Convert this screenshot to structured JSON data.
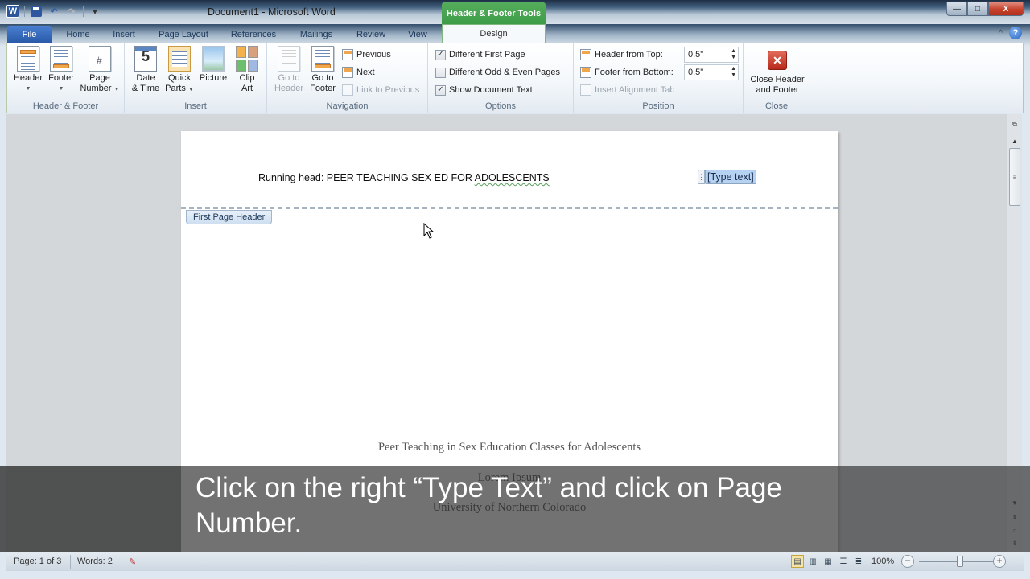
{
  "window": {
    "title": "Document1  -  Microsoft Word",
    "contextual_group": "Header & Footer Tools",
    "controls": {
      "minimize": "—",
      "maximize": "□",
      "close": "X"
    }
  },
  "quick_access": {
    "app_icon": "W",
    "undo": "↶",
    "redo": "↷",
    "customize": "▾"
  },
  "tabs": [
    {
      "label": "File",
      "active": false
    },
    {
      "label": "Home",
      "active": false
    },
    {
      "label": "Insert",
      "active": false
    },
    {
      "label": "Page Layout",
      "active": false
    },
    {
      "label": "References",
      "active": false
    },
    {
      "label": "Mailings",
      "active": false
    },
    {
      "label": "Review",
      "active": false
    },
    {
      "label": "View",
      "active": false
    },
    {
      "label": "Design",
      "active": true
    }
  ],
  "ribbon": {
    "collapse": "^",
    "help": "?",
    "groups": {
      "header_footer": {
        "label": "Header & Footer",
        "header": "Header",
        "footer": "Footer",
        "page_number_1": "Page",
        "page_number_2": "Number"
      },
      "insert": {
        "label": "Insert",
        "date_1": "Date",
        "date_2": "& Time",
        "quick_1": "Quick",
        "quick_2": "Parts",
        "picture": "Picture",
        "clip_1": "Clip",
        "clip_2": "Art"
      },
      "navigation": {
        "label": "Navigation",
        "goto_header_1": "Go to",
        "goto_header_2": "Header",
        "goto_footer_1": "Go to",
        "goto_footer_2": "Footer",
        "previous": "Previous",
        "next": "Next",
        "link_previous": "Link to Previous"
      },
      "options": {
        "label": "Options",
        "items": [
          {
            "label": "Different First Page",
            "checked": true
          },
          {
            "label": "Different Odd & Even Pages",
            "checked": false
          },
          {
            "label": "Show Document Text",
            "checked": true
          }
        ]
      },
      "position": {
        "label": "Position",
        "header_from_top_label": "Header from Top:",
        "header_from_top_value": "0.5\"",
        "footer_from_bottom_label": "Footer from Bottom:",
        "footer_from_bottom_value": "0.5\"",
        "insert_alignment_tab": "Insert Alignment Tab"
      },
      "close": {
        "label": "Close",
        "btn_1": "Close Header",
        "btn_2": "and Footer"
      }
    }
  },
  "document": {
    "running_head_prefix": "Running head: PEER TEACHING SEX ED FOR ",
    "running_head_flagged": "ADOLESCENTS",
    "type_text_placeholder": "[Type text]",
    "header_label": "First Page Header",
    "title": "Peer Teaching  in Sex Education Classes for Adolescents",
    "author": "Lorem Ipsum",
    "institution": "University of Northern Colorado"
  },
  "status": {
    "page": "Page: 1 of 3",
    "words": "Words: 2",
    "zoom": "100%",
    "zoom_percent": 100
  },
  "caption": {
    "text": "Click on the right “Type Text” and click on Page Number."
  }
}
